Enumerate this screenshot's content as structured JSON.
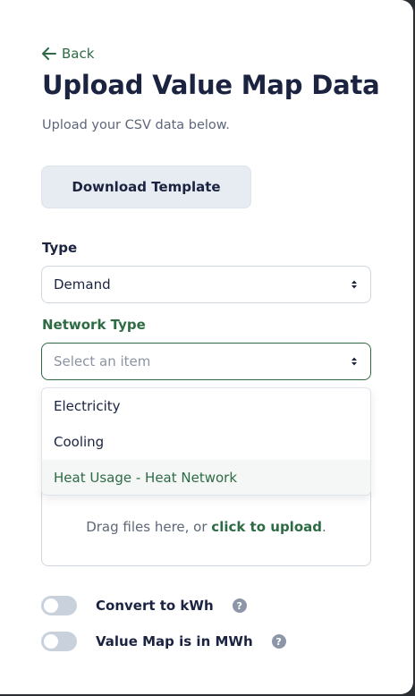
{
  "header": {
    "back_label": "Back",
    "title": "Upload Value Map Data",
    "subtitle": "Upload your CSV data below."
  },
  "download_button": {
    "label": "Download Template"
  },
  "type_field": {
    "label": "Type",
    "value": "Demand"
  },
  "network_type_field": {
    "label": "Network Type",
    "placeholder": "Select an item",
    "options": [
      "Electricity",
      "Cooling",
      "Heat Usage - Heat Network"
    ],
    "highlighted_option": "Heat Usage - Heat Network"
  },
  "upload": {
    "prefix": "Drag files here, or ",
    "link": "click to upload",
    "suffix": "."
  },
  "toggles": [
    {
      "label": "Convert to kWh",
      "on": false,
      "help": "?"
    },
    {
      "label": "Value Map is in MWh",
      "on": false,
      "help": "?"
    }
  ],
  "colors": {
    "accent_green": "#2e6b45",
    "heading": "#1b2340",
    "button_bg": "#e6ecf2",
    "toggle_off": "#c9d2dc"
  },
  "icons": {
    "back": "arrow-left-icon",
    "select_caret": "sort-caret-icon",
    "help": "question-circle-icon"
  }
}
